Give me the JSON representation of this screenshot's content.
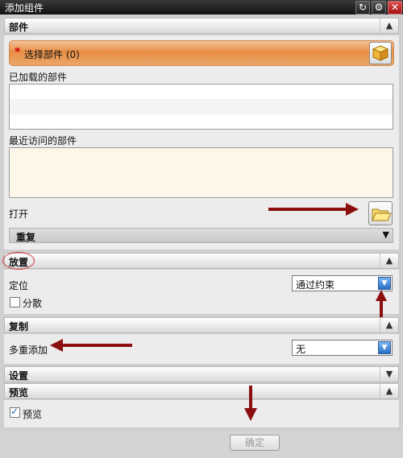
{
  "window": {
    "title": "添加组件"
  },
  "title_buttons": {
    "reset": "↻",
    "settings": "⚙",
    "close": "✕"
  },
  "section_parts": {
    "header": "部件",
    "select_required": "*",
    "select_label": "选择部件 (0)",
    "loaded_label": "已加载的部件",
    "recent_label": "最近访问的部件",
    "open_label": "打开",
    "repeat_label": "重复"
  },
  "section_place": {
    "header": "放置",
    "position_label": "定位",
    "position_value": "通过约束",
    "scatter_label": "分散"
  },
  "section_copy": {
    "header": "复制",
    "multi_label": "多重添加",
    "multi_value": "无"
  },
  "section_settings": {
    "header": "设置"
  },
  "section_preview": {
    "header": "预览",
    "preview_label": "预览"
  },
  "footer": {
    "ok_label": "确定"
  },
  "colors": {
    "accent": "#e98f45",
    "annotation": "#8b0f0f"
  }
}
